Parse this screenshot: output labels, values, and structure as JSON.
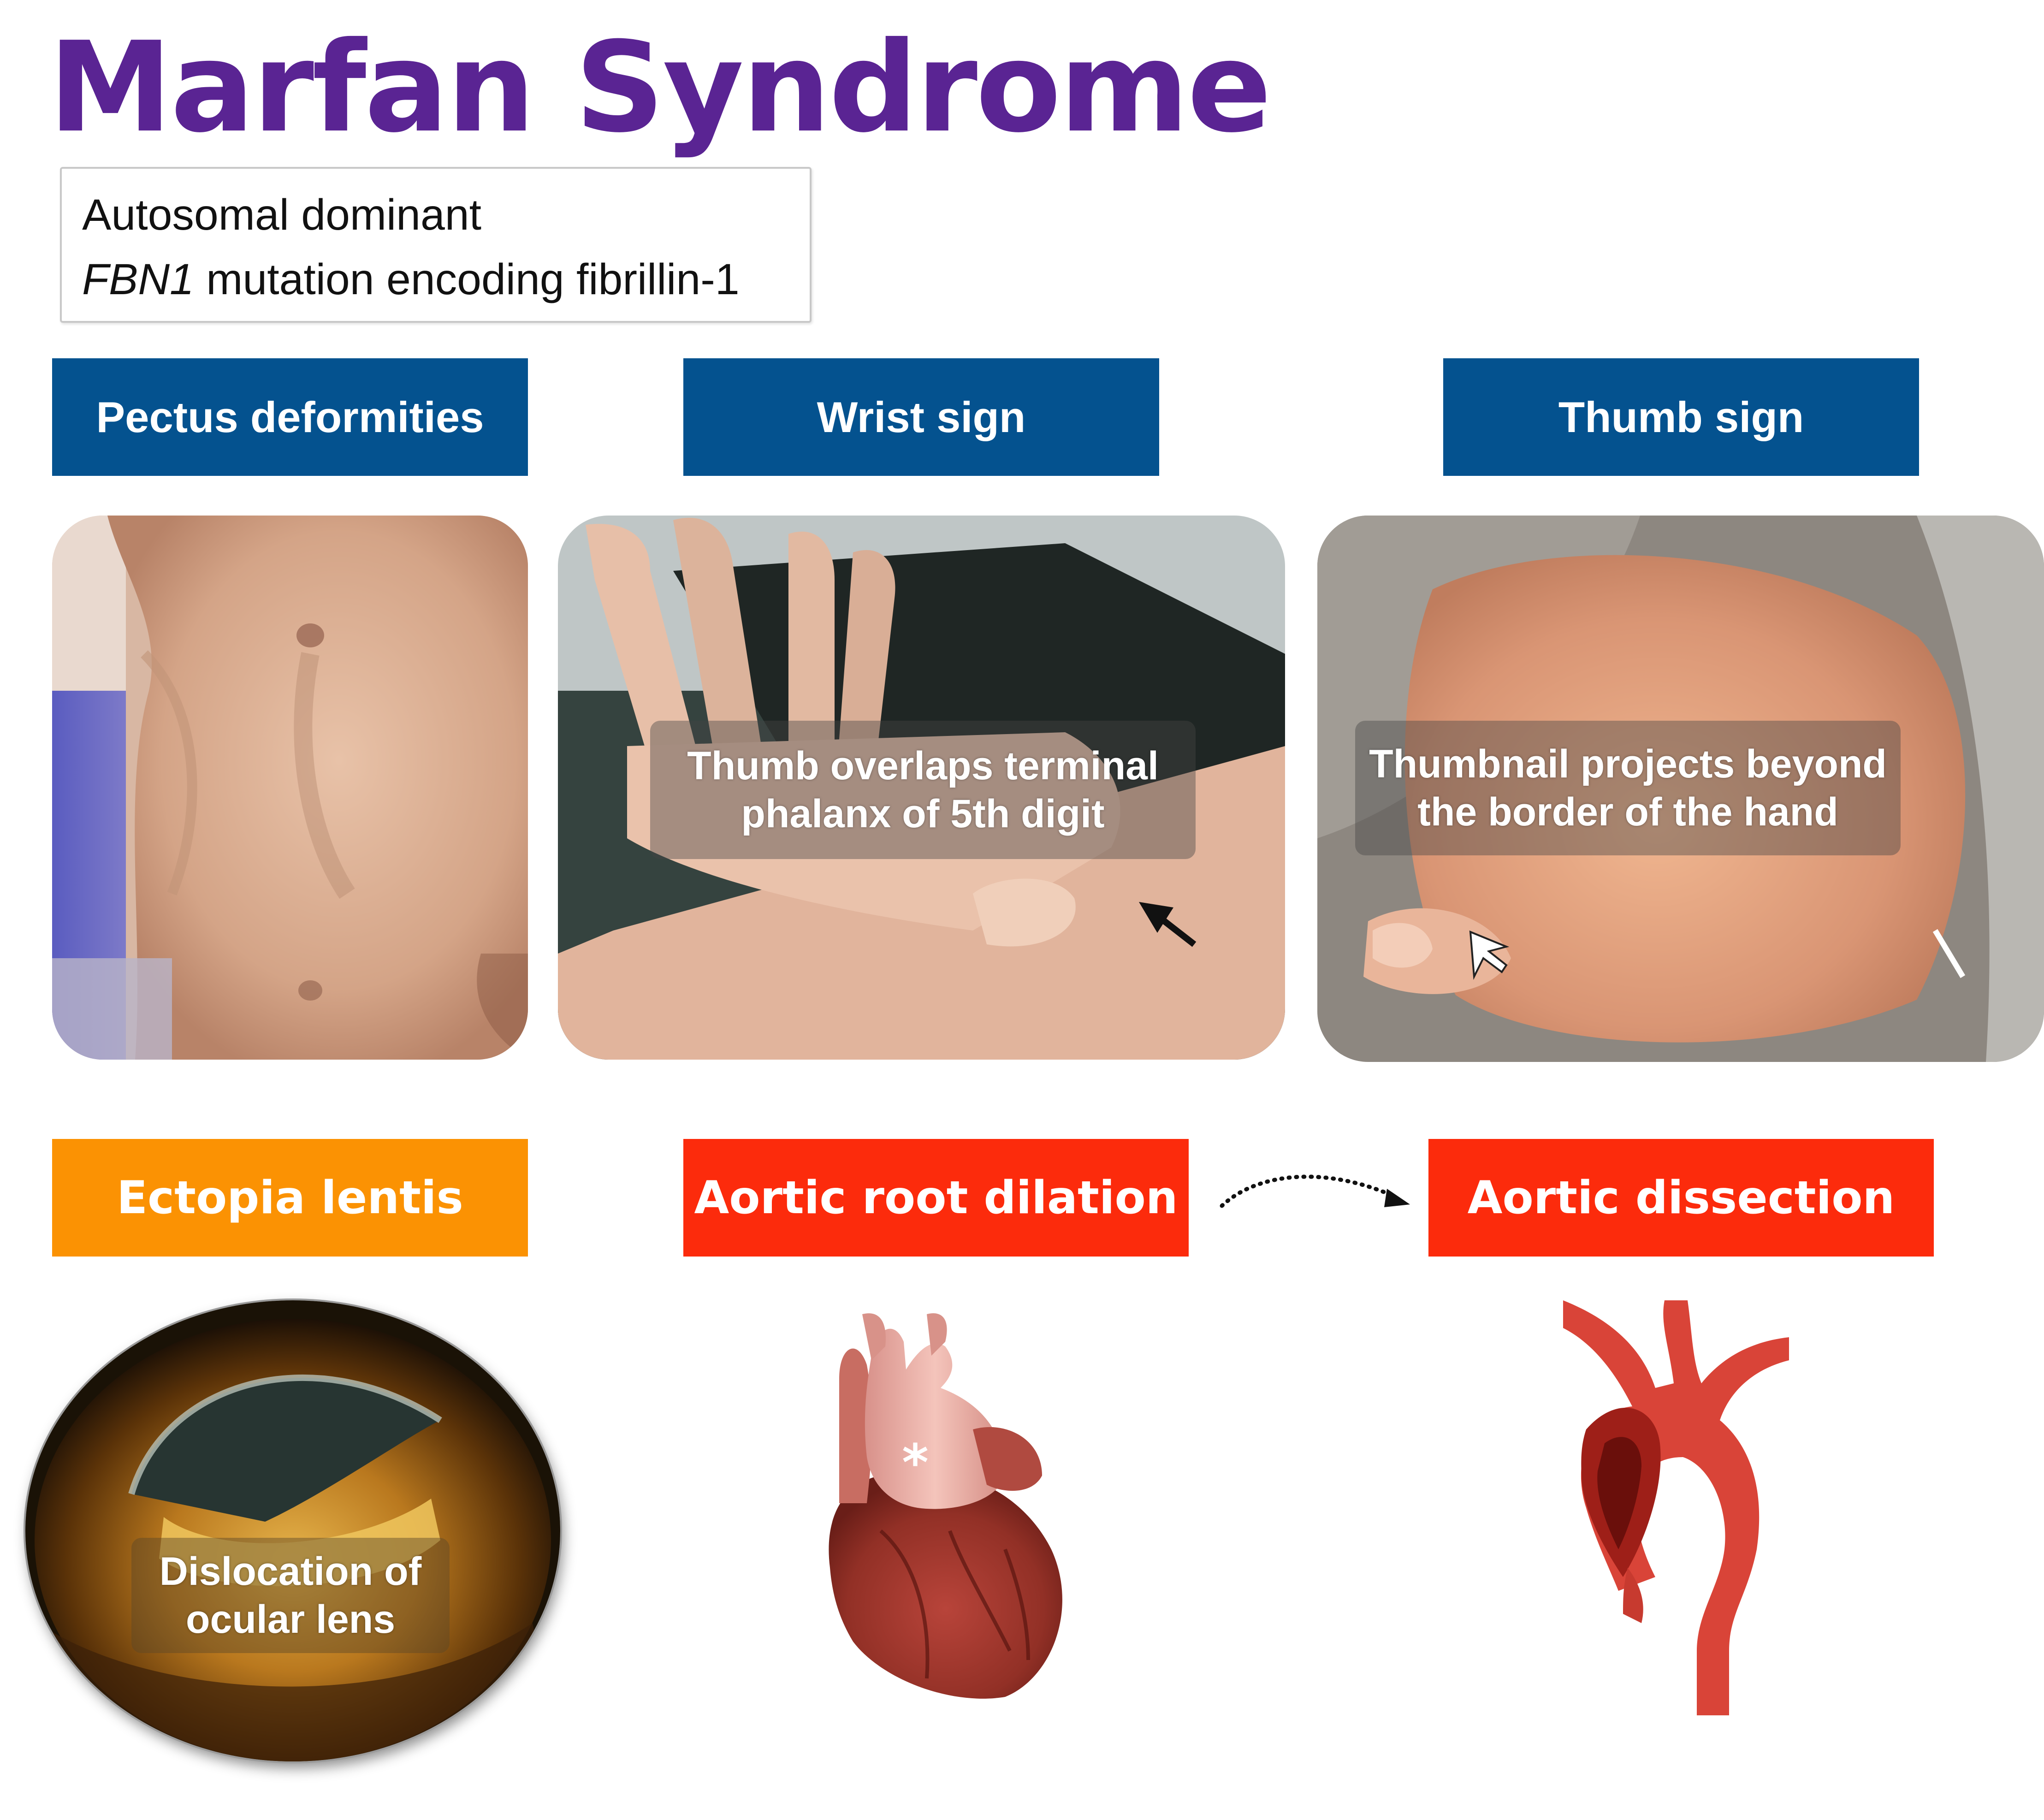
{
  "title": "Marfan Syndrome",
  "genetics": {
    "line1": "Autosomal dominant",
    "line2_gene": "FBN1",
    "line2_rest": " mutation encoding fibrillin-1"
  },
  "labels": {
    "pectus": "Pectus deformities",
    "wrist": "Wrist sign",
    "thumb": "Thumb sign",
    "ectopia": "Ectopia lentis",
    "aortic_root": "Aortic root dilation",
    "aortic_dissection": "Aortic dissection"
  },
  "captions": {
    "wrist": [
      "Thumb overlaps terminal",
      "phalanx of 5th digit"
    ],
    "thumb": [
      "Thumbnail projects beyond",
      "the border of the hand"
    ],
    "eye": [
      "Dislocation of",
      "ocular lens"
    ]
  },
  "heart_marker": "*",
  "colors": {
    "title": "#5a2493",
    "musculoskeletal_label": "#04528f",
    "ocular_label": "#fb9203",
    "cardiovascular_label": "#fc2b0c"
  },
  "icons": {
    "progression": "dotted-curved-arrow",
    "pointer": "arrow-pointer"
  }
}
